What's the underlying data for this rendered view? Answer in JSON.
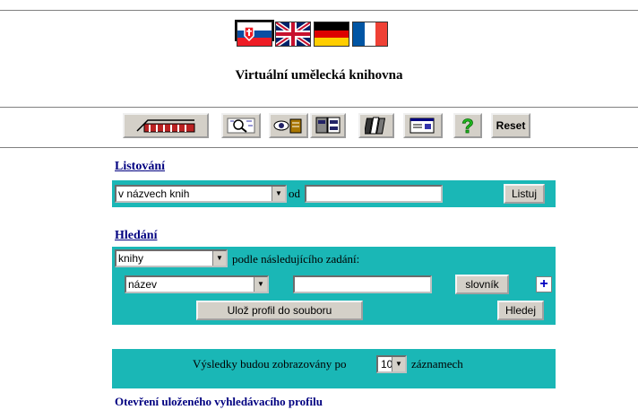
{
  "flags": [
    {
      "name": "czech-flag-icon",
      "selected": true
    },
    {
      "name": "slovak-flag-icon"
    },
    {
      "name": "uk-flag-icon"
    },
    {
      "name": "german-flag-icon"
    },
    {
      "name": "french-flag-icon"
    }
  ],
  "site_title": "Virtuální umělecká knihovna",
  "toolbar": {
    "icons": [
      "library-icon",
      "search-map-icon",
      "eye-book-icon",
      "cards-icon",
      "books-icon",
      "window-icon",
      "help-icon"
    ],
    "reset_label": "Reset"
  },
  "browse": {
    "title": "Listování",
    "select_value": "v názvech knih",
    "od_label": "od",
    "input_value": "",
    "button_label": "Listuj"
  },
  "search": {
    "title": "Hledání",
    "type_value": "knihy",
    "type_label": "podle následujícího zadání:",
    "field_value": "název",
    "field_input_value": "",
    "dictionary_label": "slovník",
    "add_label": "+",
    "save_profile_label": "Ulož profil do souboru",
    "search_label": "Hledej"
  },
  "results": {
    "prefix": "Výsledky budou zobrazovány po",
    "count": "10",
    "suffix": "záznamech"
  },
  "open_profile": "Otevření uloženého vyhledávacího profilu",
  "colors": {
    "panel": "#1ab7b6",
    "link": "#000080"
  }
}
